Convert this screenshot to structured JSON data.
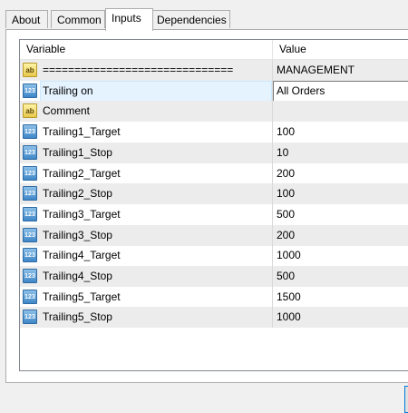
{
  "tabs": [
    {
      "label": "About"
    },
    {
      "label": "Common"
    },
    {
      "label": "Inputs",
      "active": true
    },
    {
      "label": "Dependencies"
    }
  ],
  "grid": {
    "columns": {
      "variable": "Variable",
      "value": "Value"
    },
    "rows": [
      {
        "type": "string",
        "icon": "ab",
        "variable": "==============================",
        "value": "MANAGEMENT"
      },
      {
        "type": "int",
        "icon": "123",
        "variable": "Trailing on",
        "value": "All Orders",
        "dropdown": true
      },
      {
        "type": "string",
        "icon": "ab",
        "variable": "Comment",
        "value": ""
      },
      {
        "type": "int",
        "icon": "123",
        "variable": "Trailing1_Target",
        "value": "100"
      },
      {
        "type": "int",
        "icon": "123",
        "variable": "Trailing1_Stop",
        "value": "10"
      },
      {
        "type": "int",
        "icon": "123",
        "variable": "Trailing2_Target",
        "value": "200"
      },
      {
        "type": "int",
        "icon": "123",
        "variable": "Trailing2_Stop",
        "value": "100"
      },
      {
        "type": "int",
        "icon": "123",
        "variable": "Trailing3_Target",
        "value": "500"
      },
      {
        "type": "int",
        "icon": "123",
        "variable": "Trailing3_Stop",
        "value": "200"
      },
      {
        "type": "int",
        "icon": "123",
        "variable": "Trailing4_Target",
        "value": "1000"
      },
      {
        "type": "int",
        "icon": "123",
        "variable": "Trailing4_Stop",
        "value": "500"
      },
      {
        "type": "int",
        "icon": "123",
        "variable": "Trailing5_Target",
        "value": "1500"
      },
      {
        "type": "int",
        "icon": "123",
        "variable": "Trailing5_Stop",
        "value": "1000"
      }
    ]
  }
}
